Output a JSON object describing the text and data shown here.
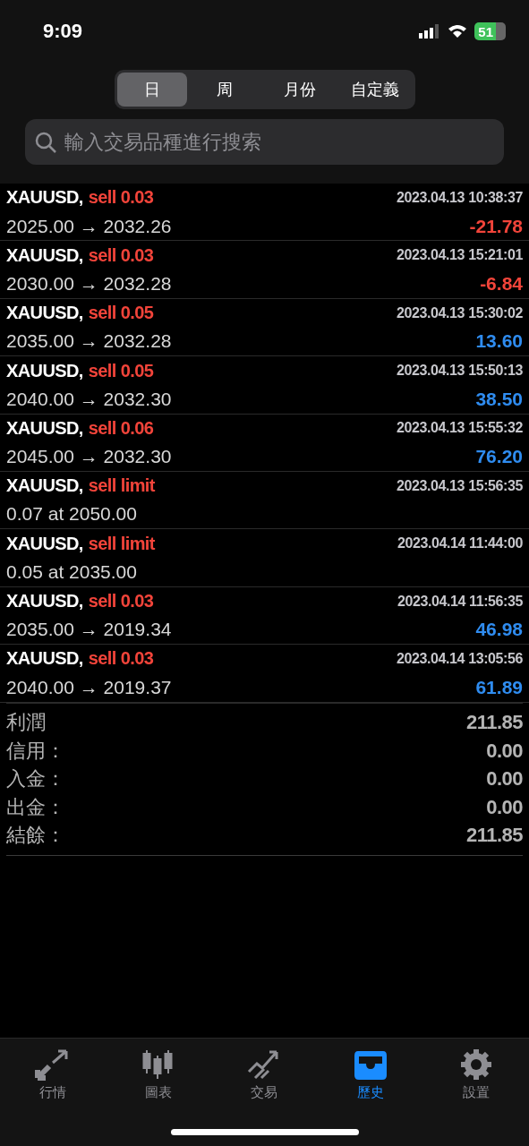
{
  "status_bar": {
    "time": "9:09",
    "battery": "51"
  },
  "periods": [
    {
      "label": "日",
      "selected": true
    },
    {
      "label": "周",
      "selected": false
    },
    {
      "label": "月份",
      "selected": false
    },
    {
      "label": "自定義",
      "selected": false
    }
  ],
  "search": {
    "placeholder": "輸入交易品種進行搜索"
  },
  "trades": [
    {
      "kind": "closed",
      "symbol": "XAUUSD,",
      "order": "sell 0.03",
      "time": "2023.04.13 10:38:37",
      "prices": "2025.00 → 2032.26",
      "profit": "-21.78",
      "loss": true
    },
    {
      "kind": "closed",
      "symbol": "XAUUSD,",
      "order": "sell 0.03",
      "time": "2023.04.13 15:21:01",
      "prices": "2030.00 → 2032.28",
      "profit": "-6.84",
      "loss": true
    },
    {
      "kind": "closed",
      "symbol": "XAUUSD,",
      "order": "sell 0.05",
      "time": "2023.04.13 15:30:02",
      "prices": "2035.00 → 2032.28",
      "profit": "13.60",
      "loss": false
    },
    {
      "kind": "closed",
      "symbol": "XAUUSD,",
      "order": "sell 0.05",
      "time": "2023.04.13 15:50:13",
      "prices": "2040.00 → 2032.30",
      "profit": "38.50",
      "loss": false
    },
    {
      "kind": "closed",
      "symbol": "XAUUSD,",
      "order": "sell 0.06",
      "time": "2023.04.13 15:55:32",
      "prices": "2045.00 → 2032.30",
      "profit": "76.20",
      "loss": false
    },
    {
      "kind": "pending",
      "symbol": "XAUUSD,",
      "order": "sell limit",
      "time": "2023.04.13 15:56:35",
      "prices": "0.07 at 2050.00"
    },
    {
      "kind": "pending",
      "symbol": "XAUUSD,",
      "order": "sell limit",
      "time": "2023.04.14 11:44:00",
      "prices": "0.05 at 2035.00"
    },
    {
      "kind": "closed",
      "symbol": "XAUUSD,",
      "order": "sell 0.03",
      "time": "2023.04.14 11:56:35",
      "prices": "2035.00 → 2019.34",
      "profit": "46.98",
      "loss": false
    },
    {
      "kind": "closed",
      "symbol": "XAUUSD,",
      "order": "sell 0.03",
      "time": "2023.04.14 13:05:56",
      "prices": "2040.00 → 2019.37",
      "profit": "61.89",
      "loss": false
    }
  ],
  "summary": [
    {
      "label": "利潤",
      "value": "211.85"
    },
    {
      "label": "信用：",
      "value": "0.00"
    },
    {
      "label": "入金：",
      "value": "0.00"
    },
    {
      "label": "出金：",
      "value": "0.00"
    },
    {
      "label": "結餘：",
      "value": "211.85"
    }
  ],
  "tab_bar": [
    {
      "kind": "quotes",
      "label": "行情",
      "selected": false
    },
    {
      "kind": "chart",
      "label": "圖表",
      "selected": false
    },
    {
      "kind": "trade",
      "label": "交易",
      "selected": false
    },
    {
      "kind": "history",
      "label": "歷史",
      "selected": true
    },
    {
      "kind": "settings",
      "label": "設置",
      "selected": false
    }
  ]
}
